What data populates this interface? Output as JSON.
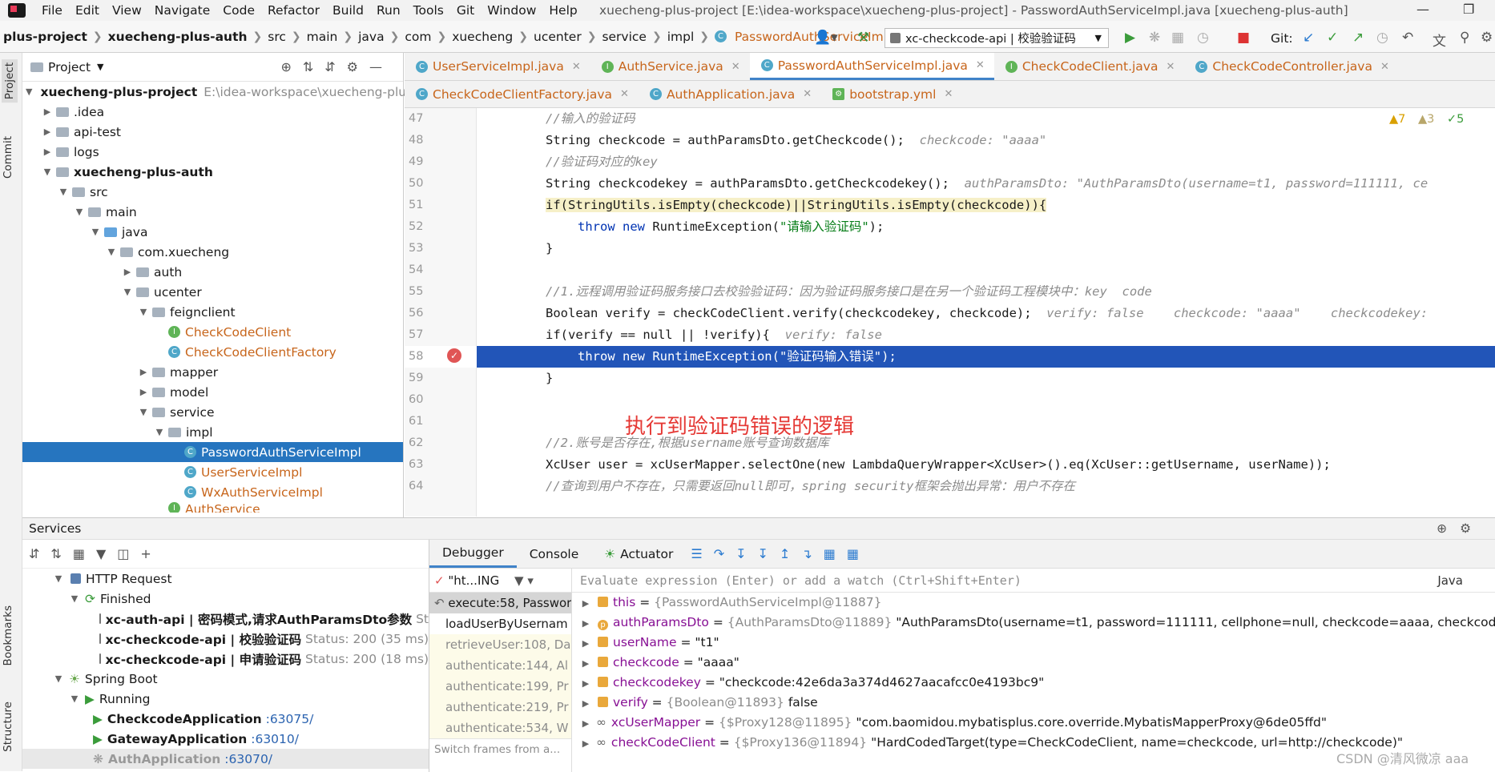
{
  "menu": {
    "items": [
      "File",
      "Edit",
      "View",
      "Navigate",
      "Code",
      "Refactor",
      "Build",
      "Run",
      "Tools",
      "Git",
      "Window",
      "Help"
    ],
    "window_title": "xuecheng-plus-project [E:\\idea-workspace\\xuecheng-plus-project] - PasswordAuthServiceImpl.java [xuecheng-plus-auth]"
  },
  "breadcrumb": [
    "plus-project",
    "xuecheng-plus-auth",
    "src",
    "main",
    "java",
    "com",
    "xuecheng",
    "ucenter",
    "service",
    "impl",
    "PasswordAuthServiceImpl"
  ],
  "run_config": "xc-checkcode-api | 校验验证码",
  "git_label": "Git:",
  "left_strip": {
    "project": "Project",
    "commit": "Commit",
    "bookmarks": "Bookmarks",
    "structure": "Structure"
  },
  "project": {
    "header": "Project",
    "tree": [
      {
        "label": "xuecheng-plus-project",
        "extra": "E:\\idea-workspace\\xuecheng-plu",
        "bold": true
      },
      {
        "label": ".idea"
      },
      {
        "label": "api-test"
      },
      {
        "label": "logs"
      },
      {
        "label": "xuecheng-plus-auth",
        "bold": true
      },
      {
        "label": "src"
      },
      {
        "label": "main"
      },
      {
        "label": "java"
      },
      {
        "label": "com.xuecheng"
      },
      {
        "label": "auth"
      },
      {
        "label": "ucenter"
      },
      {
        "label": "feignclient"
      },
      {
        "label": "CheckCodeClient"
      },
      {
        "label": "CheckCodeClientFactory"
      },
      {
        "label": "mapper"
      },
      {
        "label": "model"
      },
      {
        "label": "service"
      },
      {
        "label": "impl"
      },
      {
        "label": "PasswordAuthServiceImpl"
      },
      {
        "label": "UserServiceImpl"
      },
      {
        "label": "WxAuthServiceImpl"
      },
      {
        "label": "AuthService"
      }
    ]
  },
  "editor_tabs_row1": [
    "UserServiceImpl.java",
    "AuthService.java",
    "PasswordAuthServiceImpl.java",
    "CheckCodeClient.java",
    "CheckCodeController.java"
  ],
  "editor_tabs_row2": [
    "CheckCodeClientFactory.java",
    "AuthApplication.java",
    "bootstrap.yml"
  ],
  "inspections": {
    "warnings": "7",
    "weak_warnings": "3",
    "ok": "5"
  },
  "code": {
    "line_numbers": [
      "47",
      "48",
      "49",
      "50",
      "51",
      "52",
      "53",
      "54",
      "55",
      "56",
      "57",
      "58",
      "59",
      "60",
      "61",
      "62",
      "63",
      "64"
    ],
    "l47": "//输入的验证码",
    "l48_code": "String checkcode = authParamsDto.getCheckcode();",
    "l48_hint": "checkcode: \"aaaa\"",
    "l49": "//验证码对应的key",
    "l50_code": "String checkcodekey = authParamsDto.getCheckcodekey();",
    "l50_hint": "authParamsDto: \"AuthParamsDto(username=t1, password=111111, ce",
    "l51": "if(StringUtils.isEmpty(checkcode)||StringUtils.isEmpty(checkcode)){",
    "l52_kw": "throw new",
    "l52_rest": " RuntimeException(",
    "l52_str": "\"请输入验证码\"",
    "l52_end": ");",
    "l53": "}",
    "l55": "//1.远程调用验证码服务接口去校验验证码：因为验证码服务接口是在另一个验证码工程模块中：key  code",
    "l56_code": "Boolean verify = checkCodeClient.verify(checkcodekey, checkcode);",
    "l56_hint": "verify: false    checkcode: \"aaaa\"    checkcodekey:",
    "l57_code": "if(verify == null || !verify){",
    "l57_hint": "verify: false",
    "l58_code": "throw new RuntimeException(\"验证码输入错误\");",
    "l59": "}",
    "l62": "//2.账号是否存在,根据username账号查询数据库",
    "l63": "XcUser user = xcUserMapper.selectOne(new LambdaQueryWrapper<XcUser>().eq(XcUser::getUsername, userName));",
    "l64": "//查询到用户不存在，只需要返回null即可，spring security框架会抛出异常：用户不存在",
    "annotation": "执行到验证码错误的逻辑"
  },
  "services": {
    "title": "Services",
    "tree": [
      {
        "label": "HTTP Request"
      },
      {
        "label": "Finished"
      },
      {
        "label": "xc-auth-api | 密码模式,请求AuthParamsDto参数",
        "status": "St"
      },
      {
        "label": "xc-checkcode-api | 校验验证码",
        "status": "Status: 200 (35 ms)"
      },
      {
        "label": "xc-checkcode-api | 申请验证码",
        "status": "Status: 200 (18 ms)"
      },
      {
        "label": "Spring Boot"
      },
      {
        "label": "Running"
      },
      {
        "label": "CheckcodeApplication",
        "port": ":63075/"
      },
      {
        "label": "GatewayApplication",
        "port": ":63010/"
      },
      {
        "label": "AuthApplication",
        "port": ":63070/"
      }
    ]
  },
  "debugger": {
    "tabs": [
      "Debugger",
      "Console",
      "Actuator"
    ],
    "thread": "\"ht...ING",
    "frames": [
      "execute:58, Passwor",
      "loadUserByUsernam",
      "retrieveUser:108, Da",
      "authenticate:144, Al",
      "authenticate:199, Pr",
      "authenticate:219, Pr",
      "authenticate:534, W"
    ],
    "frames_footer": "Switch frames from a...",
    "eval_placeholder": "Evaluate expression (Enter) or add a watch (Ctrl+Shift+Enter)",
    "lang": "Java",
    "vars": [
      {
        "name": "this",
        "type": "{PasswordAuthServiceImpl@11887}",
        "value": ""
      },
      {
        "name": "authParamsDto",
        "type": "{AuthParamsDto@11889}",
        "value": "\"AuthParamsDto(username=t1, password=111111, cellphone=null, checkcode=aaaa, checkcodekey=ch"
      },
      {
        "name": "userName",
        "type": "",
        "value": "\"t1\""
      },
      {
        "name": "checkcode",
        "type": "",
        "value": "\"aaaa\""
      },
      {
        "name": "checkcodekey",
        "type": "",
        "value": "\"checkcode:42e6da3a374d4627aacafcc0e4193bc9\""
      },
      {
        "name": "verify",
        "type": "{Boolean@11893}",
        "value": "false"
      },
      {
        "name": "xcUserMapper",
        "type": "{$Proxy128@11895}",
        "value": "\"com.baomidou.mybatisplus.core.override.MybatisMapperProxy@6de05ffd\""
      },
      {
        "name": "checkCodeClient",
        "type": "{$Proxy136@11894}",
        "value": "\"HardCodedTarget(type=CheckCodeClient, name=checkcode, url=http://checkcode)\""
      }
    ]
  },
  "watermark": "CSDN @清风微凉 aaa"
}
